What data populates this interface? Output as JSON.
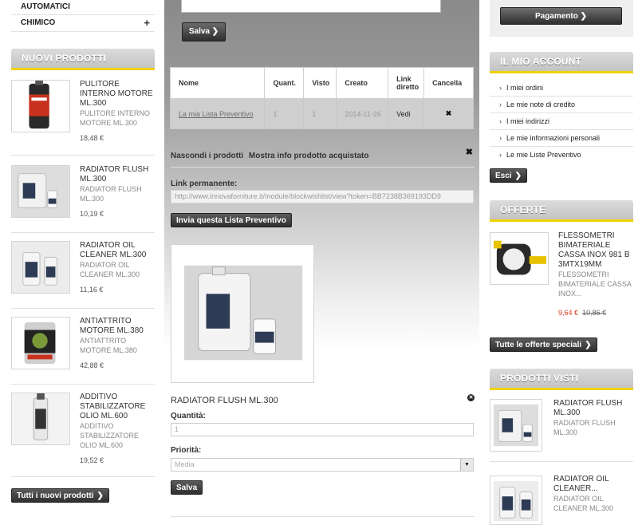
{
  "categories": [
    {
      "label": "AUTOMATICI",
      "expand": ""
    },
    {
      "label": "CHIMICO",
      "expand": "+"
    }
  ],
  "new_products": {
    "title": "NUOVI PRODOTTI",
    "items": [
      {
        "name": "PULITORE INTERNO MOTORE ML.300",
        "desc": "PULITORE INTERNO MOTORE ML.300",
        "price": "18,48 €"
      },
      {
        "name": "RADIATOR FLUSH ML.300",
        "desc": "RADIATOR FLUSH ML.300",
        "price": "10,19 €"
      },
      {
        "name": "RADIATOR OIL CLEANER ML.300",
        "desc": "RADIATOR OIL CLEANER ML.300",
        "price": "11,16 €"
      },
      {
        "name": "ANTIATTRITO MOTORE ML.380",
        "desc": "ANTIATTRITO MOTORE ML.380",
        "price": "42,88 €"
      },
      {
        "name": "ADDITIVO STABILIZZATORE OLIO ML.600",
        "desc": "ADDITIVO STABILIZZATORE OLIO ML.600",
        "price": "19,52 €"
      }
    ],
    "all_button": "Tutti i nuovi prodotti"
  },
  "wishlist": {
    "save_top": "Salva",
    "table": {
      "headers": [
        "Nome",
        "Quant.",
        "Visto",
        "Creato",
        "Link diretto",
        "Cancella"
      ],
      "row": {
        "name": "La mia Lista Preventivo",
        "qty": "1",
        "seen": "1",
        "created": "2014-11-26",
        "link": "Vedi",
        "delete": "✖"
      }
    },
    "toggle_hide": "Nascondi i prodotti",
    "toggle_info": "Mostra info prodotto acquistato",
    "close": "✖",
    "permalink_label": "Link permanente:",
    "permalink_url": "http://www.innovaforniture.it/module/blockwishlist/view?token=BB7238B369193DD9",
    "send_button": "Invia questa Lista Preventivo",
    "item": {
      "title": "RADIATOR FLUSH ML.300",
      "qty_label": "Quantità:",
      "qty_value": "1",
      "priority_label": "Priorità:",
      "priority_value": "Media",
      "save_button": "Salva"
    }
  },
  "payment_button": "Pagamento",
  "account": {
    "title": "IL MIO ACCOUNT",
    "items": [
      "I miei ordini",
      "Le mie note di credito",
      "I miei indirizzi",
      "Le mie informazioni personali",
      "Le mie Liste Preventivo"
    ],
    "logout": "Esci"
  },
  "offers": {
    "title": "OFFERTE",
    "name": "FLESSOMETRI BIMATERIALE CASSA INOX 981 B 3MTX19MM",
    "desc": "FLESSOMETRI BIMATERIALE CASSA INOX...",
    "price": "9,64 €",
    "old_price": "10,86 €",
    "all_button": "Tutte le offerte speciali"
  },
  "viewed": {
    "title": "PRODOTTI VISTI",
    "items": [
      {
        "name": "RADIATOR FLUSH ML.300",
        "desc": "RADIATOR FLUSH ML.300"
      },
      {
        "name": "RADIATOR OIL CLEANER...",
        "desc": "RADIATOR OIL CLEANER ML.300"
      }
    ]
  },
  "colors": {
    "accent_yellow": "#f0d200",
    "price_red": "#d23a1f"
  }
}
